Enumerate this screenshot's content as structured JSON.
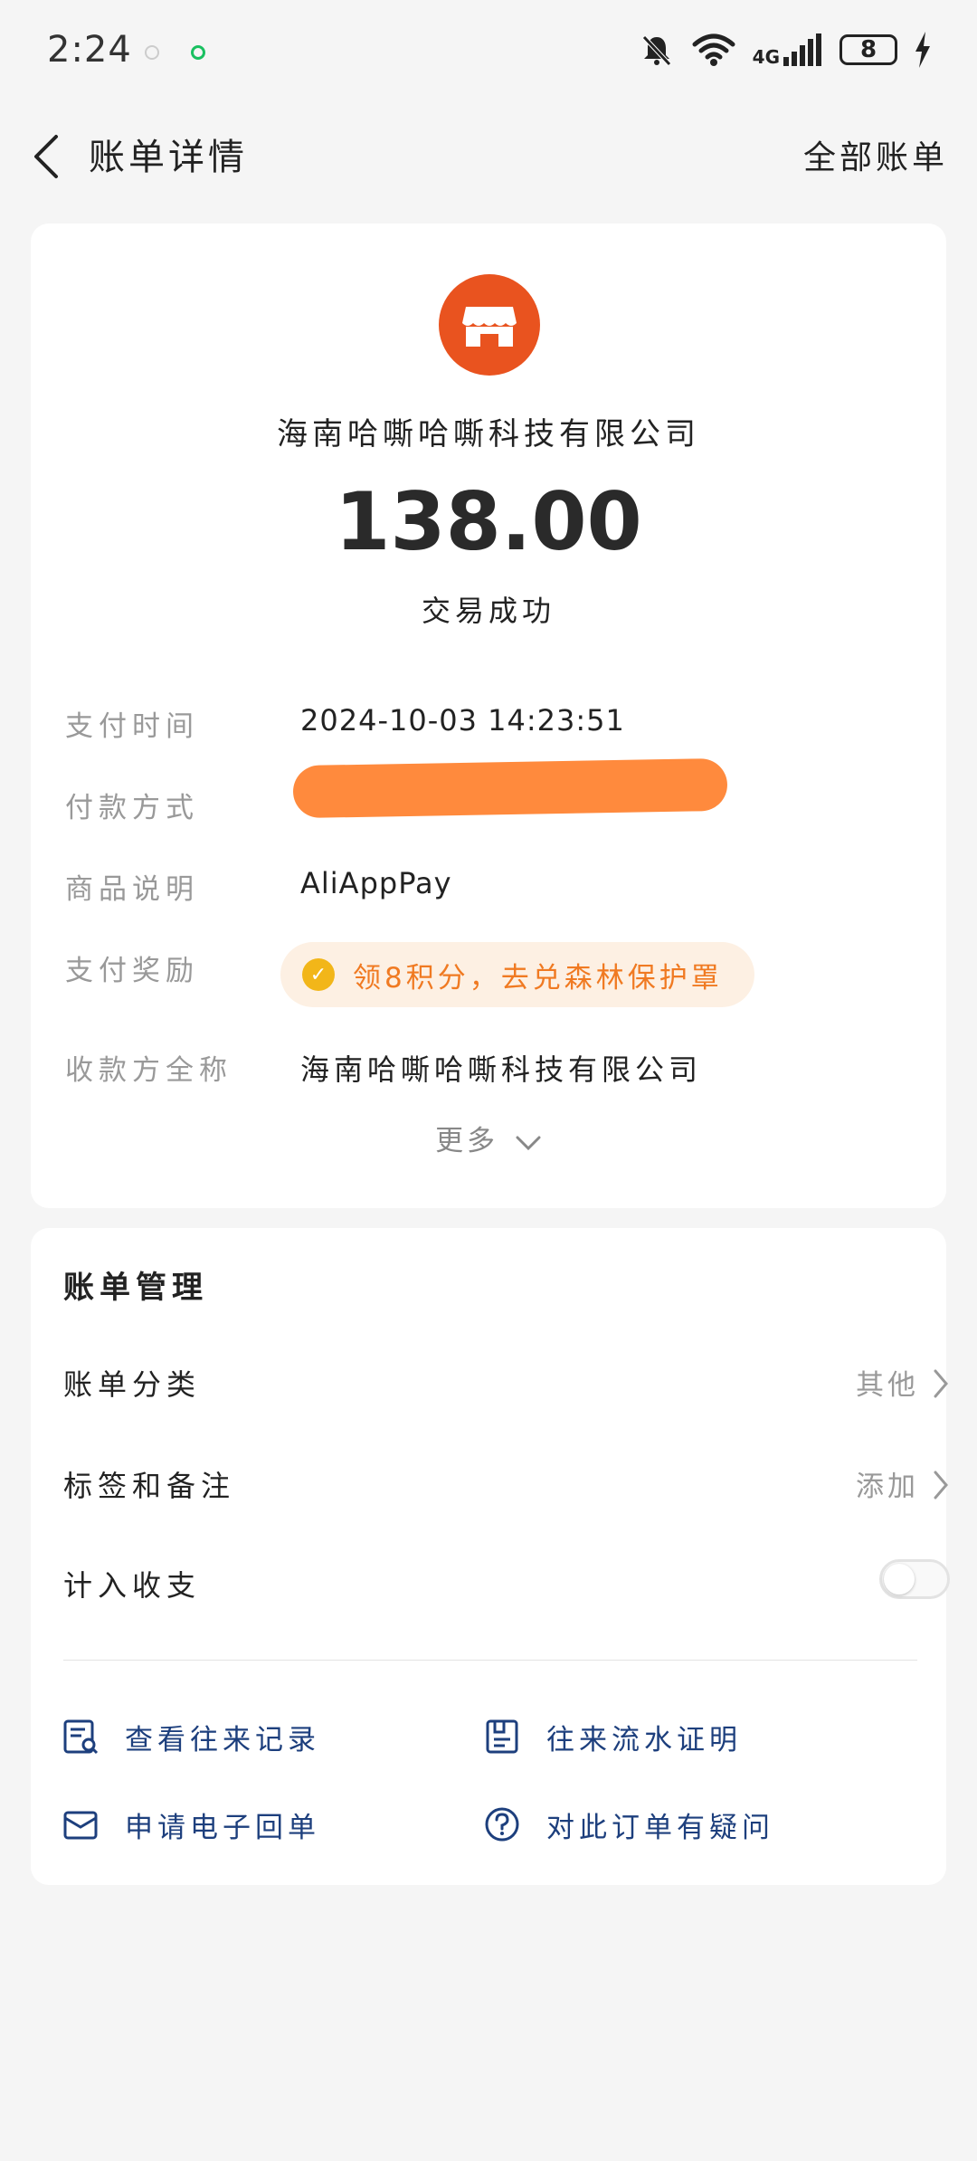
{
  "status_bar": {
    "time": "2:24",
    "network": "4G",
    "battery": "8"
  },
  "nav": {
    "title": "账单详情",
    "all_bills": "全部账单"
  },
  "detail": {
    "merchant_name": "海南哈嘶哈嘶科技有限公司",
    "amount": "138.00",
    "status": "交易成功",
    "rows": [
      {
        "label": "支付时间",
        "value": "2024-10-03 14:23:51"
      },
      {
        "label": "付款方式",
        "value": ""
      },
      {
        "label": "商品说明",
        "value": "AliAppPay"
      },
      {
        "label": "支付奖励",
        "value": "领8积分，去兑森林保护罩"
      },
      {
        "label": "收款方全称",
        "value": "海南哈嘶哈嘶科技有限公司"
      }
    ],
    "more": "更多",
    "colors": {
      "logo": "#e9531f",
      "reward_text": "#f07a22",
      "reward_bg": "#fdf0e3"
    }
  },
  "manage": {
    "title": "账单管理",
    "category": {
      "label": "账单分类",
      "value": "其他"
    },
    "tags": {
      "label": "标签和备注",
      "value": "添加"
    },
    "include": {
      "label": "计入收支",
      "enabled": false
    },
    "actions": [
      {
        "label": "查看往来记录",
        "icon": "record-search-icon"
      },
      {
        "label": "往来流水证明",
        "icon": "statement-icon"
      },
      {
        "label": "申请电子回单",
        "icon": "mail-icon"
      },
      {
        "label": "对此订单有疑问",
        "icon": "question-icon"
      }
    ],
    "colors": {
      "action": "#1d3f7d"
    }
  }
}
